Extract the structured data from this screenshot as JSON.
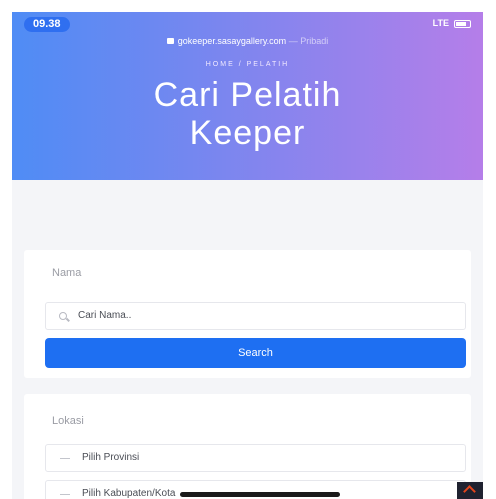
{
  "status_bar": {
    "time": "09.38",
    "carrier": "LTE"
  },
  "browser": {
    "url": "gokeeper.sasaygallery.com",
    "url_suffix": "— Pribadi"
  },
  "hero": {
    "breadcrumb": "HOME  /  PELATIH",
    "title_line1": "Cari Pelatih",
    "title_line2": "Keeper"
  },
  "search_card": {
    "label": "Nama",
    "placeholder": "Cari Nama..",
    "button_label": "Search"
  },
  "location_card": {
    "label": "Lokasi",
    "province_placeholder": "Pilih Provinsi",
    "city_placeholder": "Pilih Kabupaten/Kota"
  },
  "colors": {
    "accent": "#1e6ff2",
    "gradient_start": "#4f8cf5",
    "gradient_end": "#b57ee9"
  }
}
